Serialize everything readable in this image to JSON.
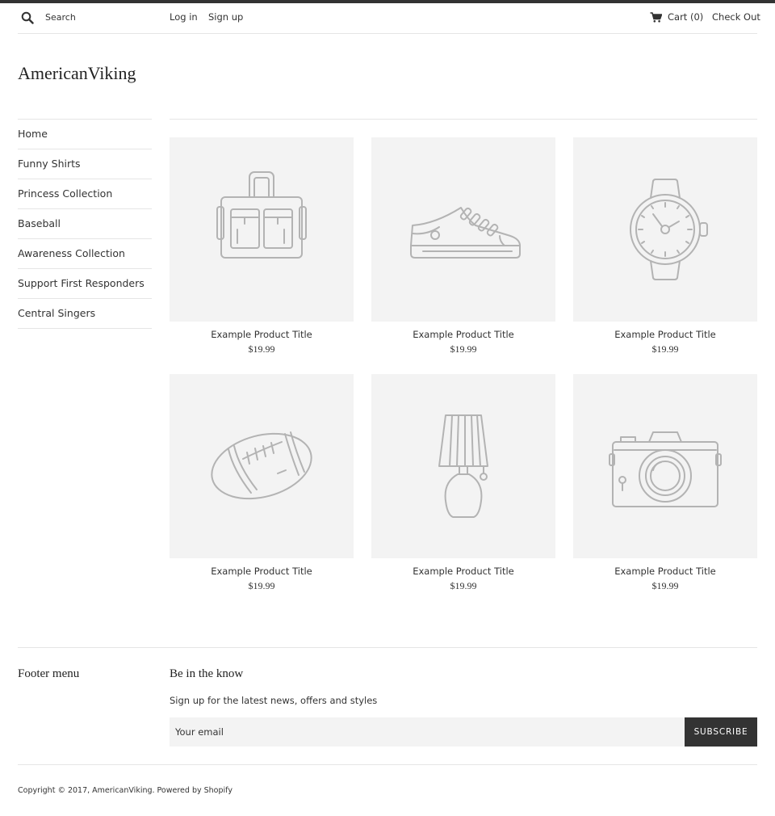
{
  "header": {
    "search_placeholder": "Search",
    "login_label": "Log in",
    "signup_label": "Sign up",
    "cart_label": "Cart (0)",
    "checkout_label": "Check Out"
  },
  "brand": {
    "logo_text": "AmericanViking"
  },
  "sidebar": {
    "items": [
      {
        "label": "Home"
      },
      {
        "label": "Funny Shirts"
      },
      {
        "label": "Princess Collection"
      },
      {
        "label": "Baseball"
      },
      {
        "label": "Awareness Collection"
      },
      {
        "label": "Support First Responders"
      },
      {
        "label": "Central Singers"
      }
    ]
  },
  "products": [
    {
      "title": "Example Product Title",
      "price": "$19.99",
      "icon": "bag-icon"
    },
    {
      "title": "Example Product Title",
      "price": "$19.99",
      "icon": "sneaker-icon"
    },
    {
      "title": "Example Product Title",
      "price": "$19.99",
      "icon": "watch-icon"
    },
    {
      "title": "Example Product Title",
      "price": "$19.99",
      "icon": "football-icon"
    },
    {
      "title": "Example Product Title",
      "price": "$19.99",
      "icon": "lamp-icon"
    },
    {
      "title": "Example Product Title",
      "price": "$19.99",
      "icon": "camera-icon"
    }
  ],
  "footer": {
    "menu_heading": "Footer menu",
    "newsletter_heading": "Be in the know",
    "newsletter_text": "Sign up for the latest news, offers and styles",
    "email_placeholder": "Your email",
    "subscribe_label": "SUBSCRIBE",
    "copyright": "Copyright © 2017, AmericanViking. Powered by Shopify"
  },
  "colors": {
    "accent_dark": "#333333",
    "placeholder_bg": "#f3f3f3",
    "icon_stroke": "#b3b3b3",
    "divider": "#e5e5e5"
  }
}
